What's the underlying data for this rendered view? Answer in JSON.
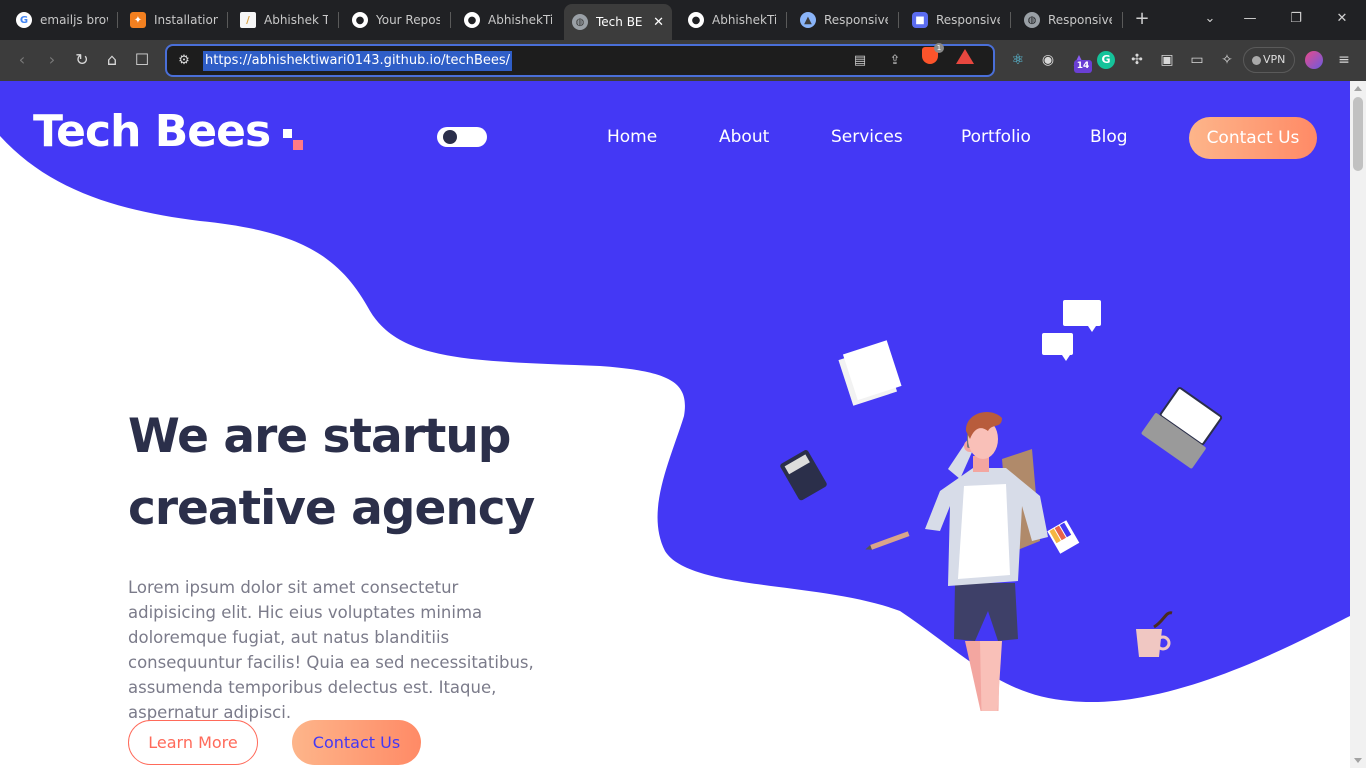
{
  "browser": {
    "tabs": [
      {
        "title": "emailjs brow",
        "favicon": "google-icon",
        "color": "#4285f4",
        "glyph": "G"
      },
      {
        "title": "Installation",
        "favicon": "orange-logo-icon",
        "color": "#f38020",
        "glyph": "✦"
      },
      {
        "title": "Abhishek Ti",
        "favicon": "document-icon",
        "color": "#f6f6f6",
        "glyph": "▮"
      },
      {
        "title": "Your Reposi",
        "favicon": "github-icon",
        "color": "#ffffff",
        "glyph": "●"
      },
      {
        "title": "AbhishekTiw",
        "favicon": "github-icon",
        "color": "#ffffff",
        "glyph": "●"
      },
      {
        "title": "Tech BE",
        "favicon": "globe-icon",
        "color": "#9aa0a6",
        "glyph": "◍"
      },
      {
        "title": "AbhishekTiw",
        "favicon": "github-icon",
        "color": "#ffffff",
        "glyph": "●"
      },
      {
        "title": "Responsive",
        "favicon": "app-icon",
        "color": "#8ab4f8",
        "glyph": "▲"
      },
      {
        "title": "Responsive",
        "favicon": "app-icon",
        "color": "#5b6cf0",
        "glyph": "■"
      },
      {
        "title": "Responsive",
        "favicon": "globe-icon",
        "color": "#9aa0a6",
        "glyph": "◍"
      }
    ],
    "active_tab_index": 5,
    "url": "https://abhishektiwari0143.github.io/techBees/",
    "extension_badge": "14",
    "brave_badge": "1",
    "vpn_label": "VPN"
  },
  "site": {
    "logo": "Tech Bees",
    "nav": {
      "home": "Home",
      "about": "About",
      "services": "Services",
      "portfolio": "Portfolio",
      "blog": "Blog",
      "contact": "Contact Us"
    },
    "hero": {
      "title_line1": "We are startup",
      "title_line2": "creative agency",
      "description": "Lorem ipsum dolor sit amet consectetur adipisicing elit. Hic eius voluptates minima doloremque fugiat, aut natus blanditiis consequuntur facilis! Quia ea sed necessitatibus, assumenda temporibus delectus est. Itaque, aspernatur adipisci.",
      "learn_more": "Learn More",
      "contact": "Contact Us"
    },
    "colors": {
      "brand_blue": "#4438f5",
      "dark_text": "#2b2f4a",
      "accent_orange": "#ff8a66",
      "accent_pink": "#ff7a85"
    }
  }
}
